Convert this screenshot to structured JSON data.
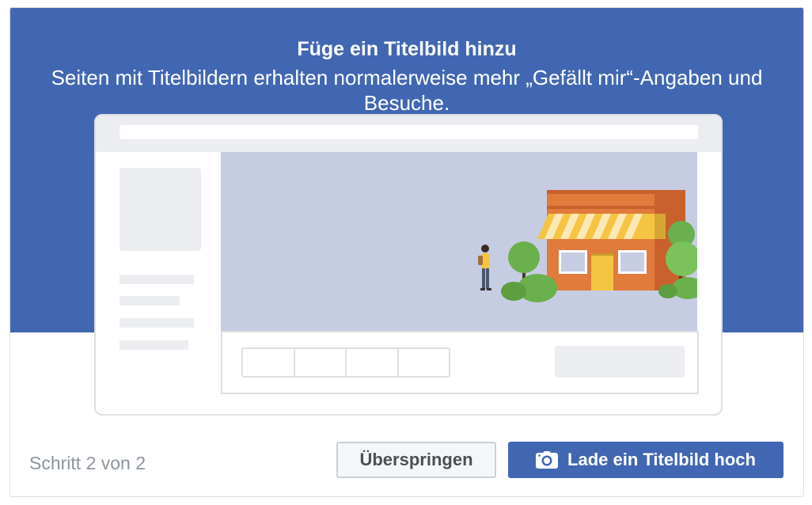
{
  "dialog": {
    "title": "Füge ein Titelbild hinzu",
    "subtitle": "Seiten mit Titelbildern erhalten normalerweise mehr „Gefällt mir“-Angaben und Besuche."
  },
  "footer": {
    "step_text": "Schritt 2 von 2",
    "skip_label": "Überspringen",
    "upload_label": "Lade ein Titelbild hoch",
    "upload_icon": "camera-icon"
  },
  "colors": {
    "brand_blue": "#4267b2",
    "cover_bg": "#c6cde3",
    "placeholder_grey": "#ebedf0",
    "shop_orange": "#e07b3c",
    "awning_yellow": "#f4c542",
    "tree_green": "#6ab04c"
  }
}
